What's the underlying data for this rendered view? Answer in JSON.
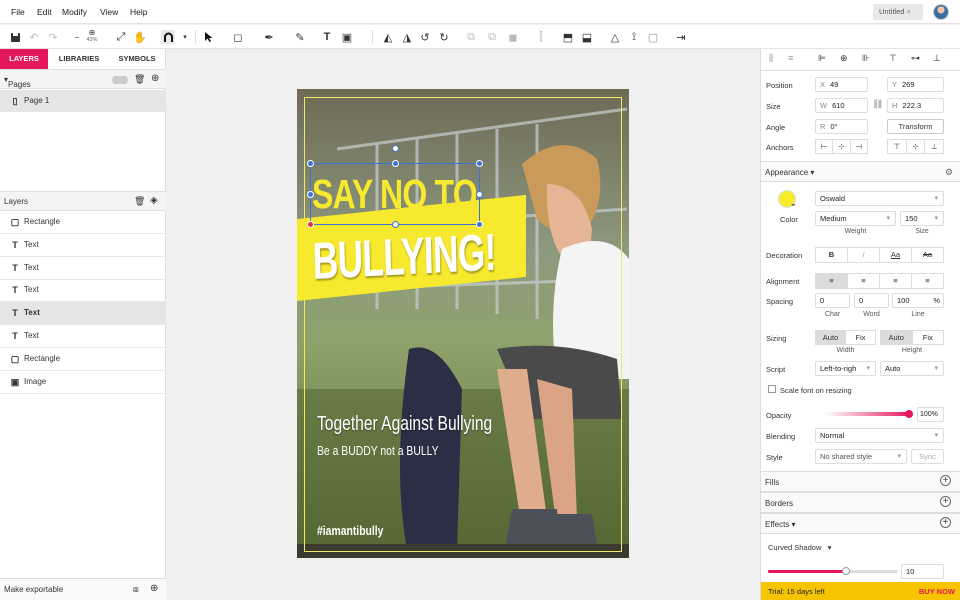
{
  "menubar": {
    "items": [
      "File",
      "Edit",
      "Modify",
      "View",
      "Help"
    ],
    "doc_tab": "Untitled",
    "doc_tab_close": "×"
  },
  "toolbar": {
    "zoom": "43%"
  },
  "left": {
    "tabs": [
      "LAYERS",
      "LIBRARIES",
      "SYMBOLS"
    ],
    "pages_header": "Pages",
    "pages": [
      "Page 1"
    ],
    "layers_header": "Layers",
    "layers": [
      {
        "name": "Rectangle",
        "type": "rect"
      },
      {
        "name": "Text",
        "type": "text"
      },
      {
        "name": "Text",
        "type": "text"
      },
      {
        "name": "Text",
        "type": "text"
      },
      {
        "name": "Text",
        "type": "text",
        "selected": true
      },
      {
        "name": "Text",
        "type": "text"
      },
      {
        "name": "Rectangle",
        "type": "rect"
      },
      {
        "name": "Image",
        "type": "image"
      }
    ],
    "footer": "Make exportable"
  },
  "artboard": {
    "headline1": "SAY NO TO",
    "headline2": "BULLYING!",
    "subtitle": "Together Against Bullying",
    "tagline": "Be a BUDDY not a BULLY",
    "hashtag": "#iamantibully",
    "accent_color": "#f7e92e"
  },
  "inspector": {
    "position_label": "Position",
    "x_pre": "X",
    "x": "49",
    "y_pre": "Y",
    "y": "269",
    "size_label": "Size",
    "w_pre": "W",
    "w": "610",
    "h_pre": "H",
    "h": "222.3",
    "angle_label": "Angle",
    "r_pre": "R",
    "angle": "0°",
    "transform_btn": "Transform",
    "anchors_label": "Anchors",
    "appearance": "Appearance",
    "color_label": "Color",
    "color_value": "#f6ec2c",
    "font": "Oswald",
    "weight": "Medium",
    "weight_label": "Weight",
    "size_val": "150",
    "size_sub": "Size",
    "decoration_label": "Decoration",
    "deco": [
      "B",
      "I",
      "Aa",
      "Aa"
    ],
    "alignment_label": "Alignment",
    "spacing_label": "Spacing",
    "char": "0",
    "word": "0",
    "line": "100",
    "line_unit": "%",
    "char_label": "Char",
    "word_label": "Word",
    "line_label": "Line",
    "sizing_label": "Sizing",
    "sizing_w": [
      "Auto",
      "Fix"
    ],
    "sizing_h": [
      "Auto",
      "Fix"
    ],
    "width_label": "Width",
    "height_label": "Height",
    "script_label": "Script",
    "script": "Left-to-righ",
    "script2": "Auto",
    "scale_font": "Scale font on resizing",
    "opacity_label": "Opacity",
    "opacity": "100%",
    "opacity_frac": 1.0,
    "blending_label": "Blending",
    "blending": "Normal",
    "style_label": "Style",
    "style": "No shared style",
    "sync": "Sync",
    "fills": "Fills",
    "borders": "Borders",
    "effects": "Effects",
    "effect_name": "Curved Shadow",
    "effect_value": "10",
    "effect_frac": 0.6
  },
  "trial": {
    "text": "Trial: 15 days left",
    "buy": "BUY NOW"
  }
}
